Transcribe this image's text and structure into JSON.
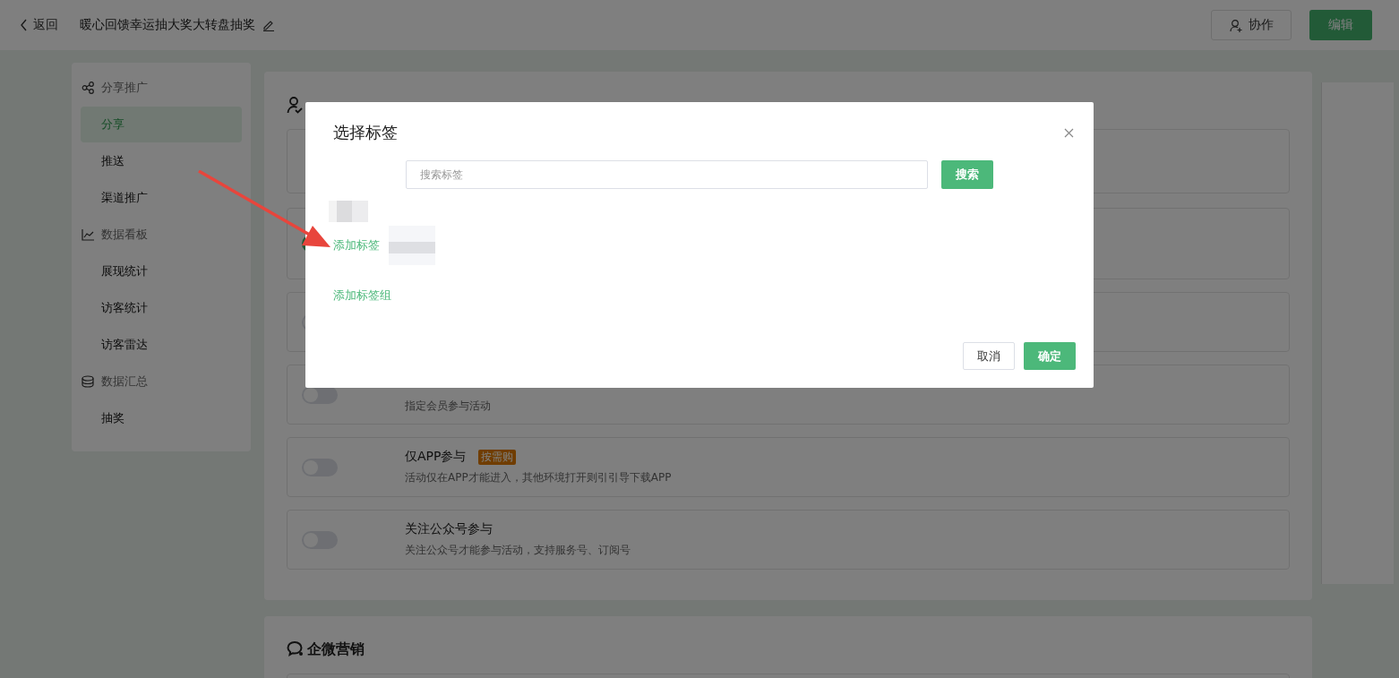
{
  "header": {
    "back": "返回",
    "title": "暖心回馈幸运抽大奖大转盘抽奖",
    "buttons": [
      {
        "kind": "outline",
        "label": "协作"
      },
      {
        "kind": "primary",
        "label": "编辑"
      }
    ]
  },
  "sidebar": {
    "groups": [
      {
        "label": "分享推广",
        "items": [
          {
            "label": "分享",
            "selected": true
          },
          {
            "label": "推送",
            "selected": false
          },
          {
            "label": "渠道推广",
            "selected": false
          }
        ]
      },
      {
        "label": "数据看板",
        "items": [
          {
            "label": "展现统计",
            "selected": false
          },
          {
            "label": "访客统计",
            "selected": false
          },
          {
            "label": "访客雷达",
            "selected": false
          }
        ]
      },
      {
        "label": "数据汇总",
        "items": [
          {
            "label": "抽奖",
            "selected": false
          }
        ]
      }
    ]
  },
  "sections": [
    {
      "cards": [
        {
          "kind": "plain"
        },
        {
          "kind": "toggle",
          "on": true
        },
        {
          "kind": "toggle",
          "on": false
        },
        {
          "kind": "toggle",
          "on": false,
          "description": "指定会员参与活动"
        },
        {
          "kind": "toggle",
          "on": false,
          "title": "仅APP参与",
          "badge": "按需购",
          "description": "活动仅在APP才能进入，其他环境打开则引引导下载APP"
        },
        {
          "kind": "toggle",
          "on": false,
          "title": "关注公众号参与",
          "description": "关注公众号才能参与活动，支持服务号、订阅号"
        }
      ]
    },
    {
      "title": "企微营销",
      "cards": [
        {
          "kind": "plain"
        }
      ]
    }
  ],
  "dialog": {
    "title": "选择标签",
    "search": {
      "placeholder": "搜索标签",
      "button": "搜索"
    },
    "links": [
      "添加标签",
      "添加标签组"
    ],
    "buttons": [
      {
        "kind": "cancel",
        "label": "取消"
      },
      {
        "kind": "confirm",
        "label": "确定"
      }
    ]
  }
}
